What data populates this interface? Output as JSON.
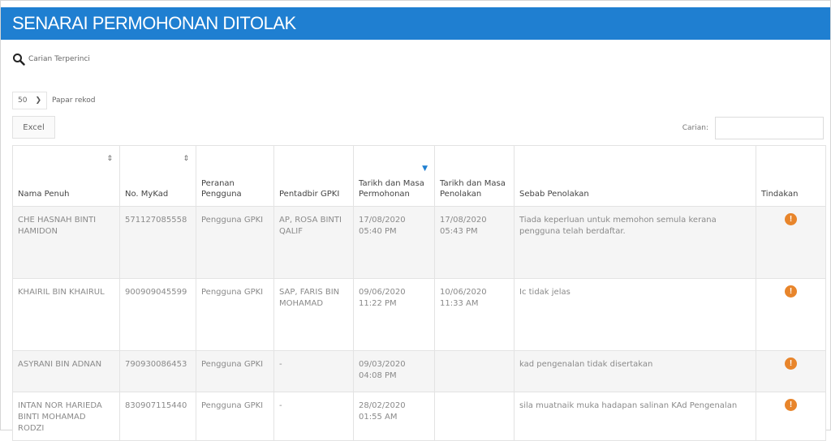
{
  "header": {
    "title": "SENARAI PERMOHONAN DITOLAK"
  },
  "search": {
    "label": "Carian Terperinci"
  },
  "length": {
    "value": "50",
    "label": "Papar rekod"
  },
  "toolbar": {
    "excel_label": "Excel",
    "filter_label": "Carian:"
  },
  "columns": [
    "Nama Penuh",
    "No. MyKad",
    "Peranan Pengguna",
    "Pentadbir GPKI",
    "Tarikh dan Masa Permohonan",
    "Tarikh dan Masa Penolakan",
    "Sebab Penolakan",
    "Tindakan"
  ],
  "rows": [
    {
      "nama": "CHE HASNAH BINTI HAMIDON",
      "mykad": "571127085558",
      "peranan": "Pengguna GPKI",
      "pentadbir": "AP, ROSA BINTI QALIF",
      "mohon": "17/08/2020 05:40 PM",
      "tolak": "17/08/2020 05:43 PM",
      "sebab": "Tiada keperluan untuk memohon semula kerana pengguna telah berdaftar.",
      "tindakan": "!"
    },
    {
      "nama": "KHAIRIL BIN KHAIRUL",
      "mykad": "900909045599",
      "peranan": "Pengguna GPKI",
      "pentadbir": "SAP, FARIS BIN MOHAMAD",
      "mohon": "09/06/2020 11:22 PM",
      "tolak": "10/06/2020 11:33 AM",
      "sebab": "Ic tidak jelas",
      "tindakan": "!"
    },
    {
      "nama": "ASYRANI BIN ADNAN",
      "mykad": "790930086453",
      "peranan": "Pengguna GPKI",
      "pentadbir": "-",
      "mohon": "09/03/2020 04:08 PM",
      "tolak": "",
      "sebab": "kad pengenalan tidak disertakan",
      "tindakan": "!"
    },
    {
      "nama": "INTAN NOR HARIEDA BINTI MOHAMAD RODZI",
      "mykad": "830907115440",
      "peranan": "Pengguna GPKI",
      "pentadbir": "-",
      "mohon": "28/02/2020 01:55 AM",
      "tolak": "",
      "sebab": "sila muatnaik muka hadapan salinan KAd Pengenalan",
      "tindakan": "!"
    }
  ],
  "icons": {
    "search": "search-icon",
    "dropdown": "chevron-down-icon",
    "action": "info-icon",
    "sort": "sort-icon"
  },
  "colors": {
    "header": "#1f7fd1",
    "action": "#e8852b"
  }
}
